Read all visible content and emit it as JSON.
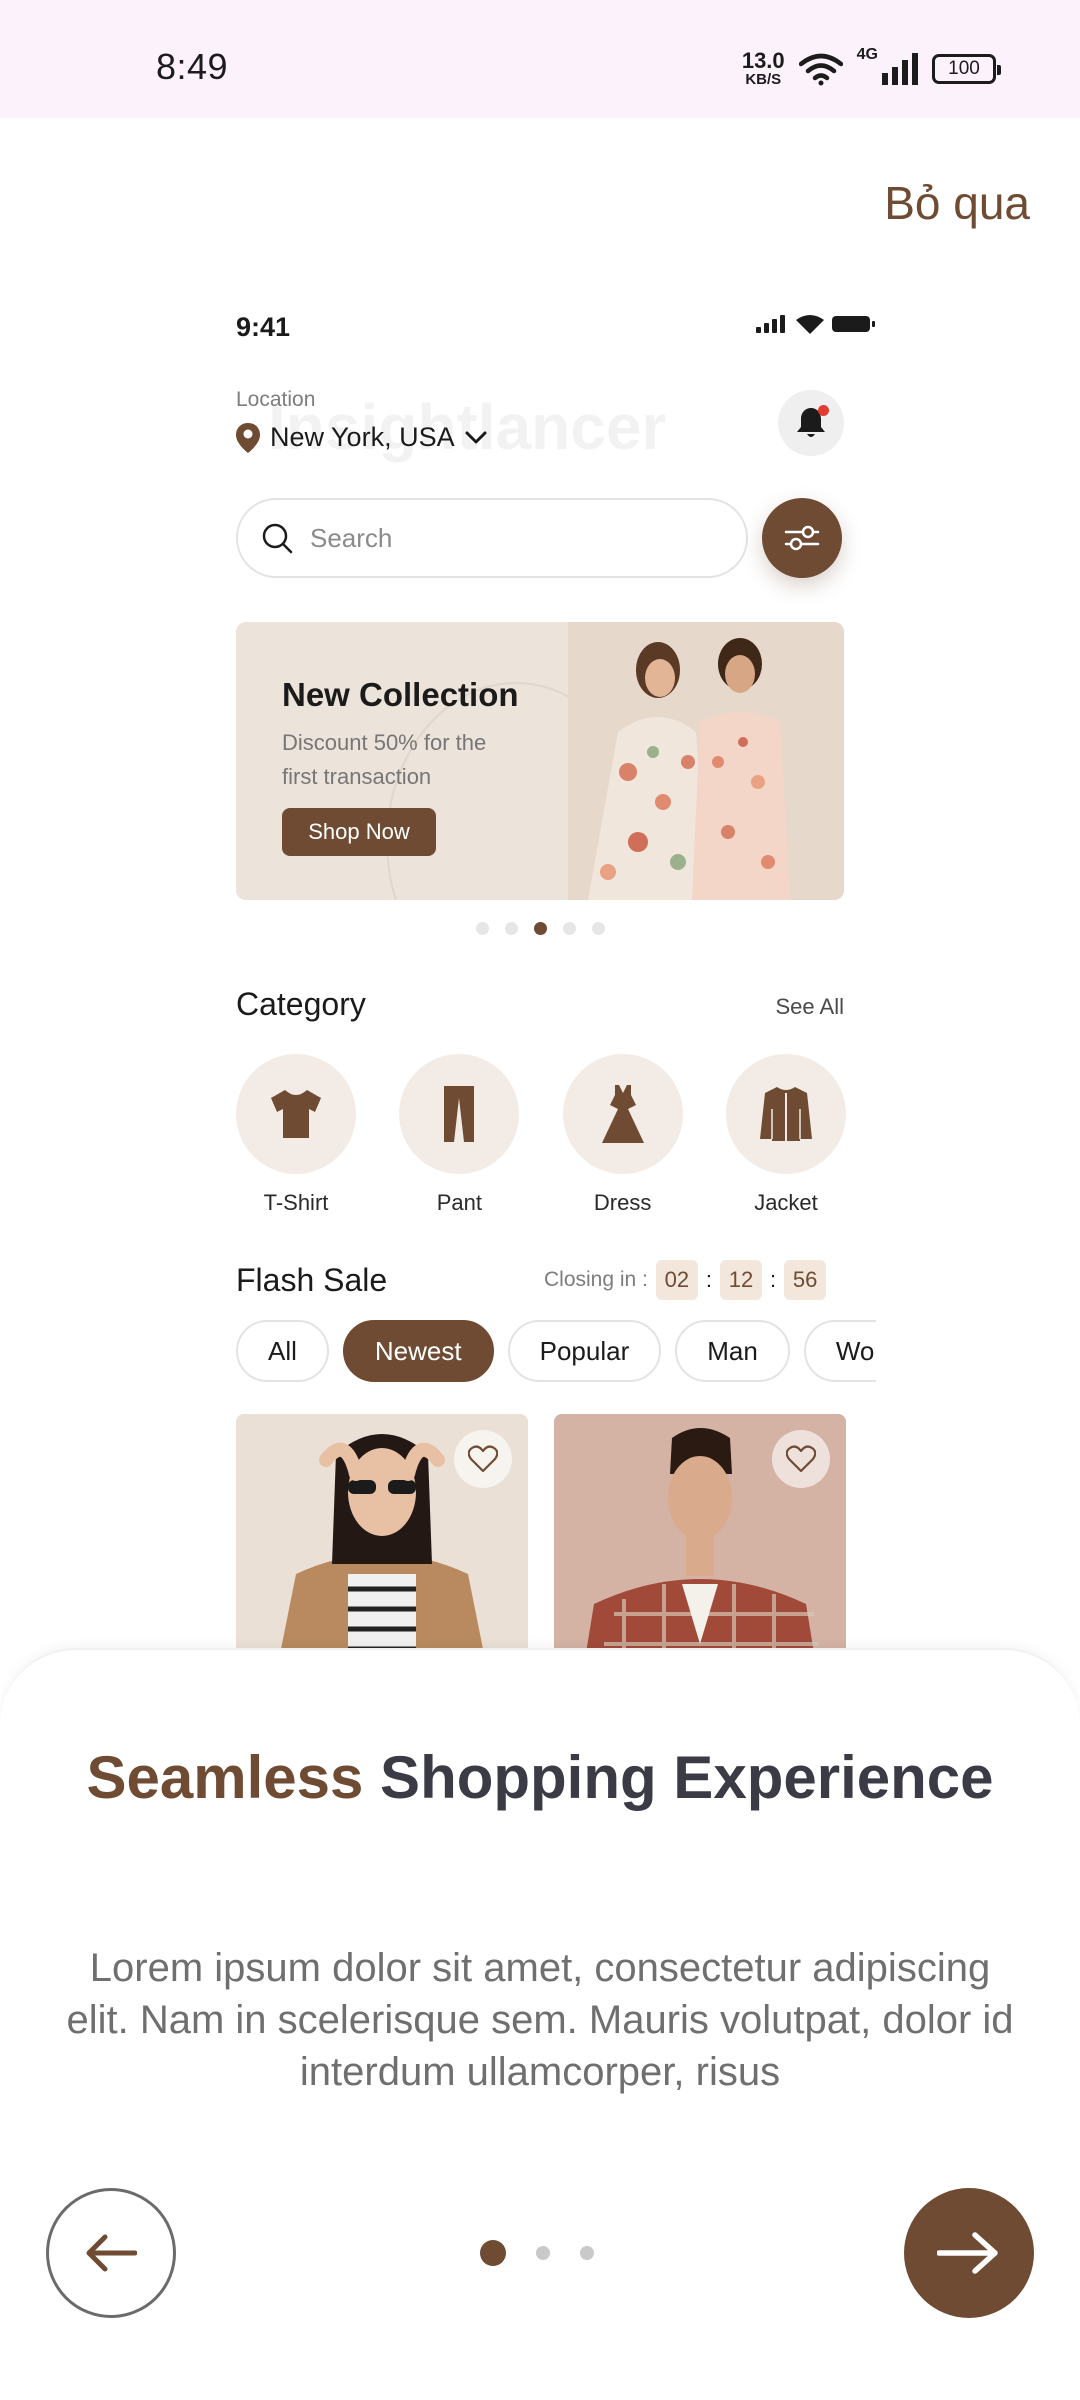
{
  "status_bar": {
    "time": "8:49",
    "net_speed": "13.0",
    "net_unit": "KB/S",
    "network": "4G",
    "battery": "100",
    "icons": [
      "wifi-icon",
      "signal-icon",
      "battery-icon"
    ]
  },
  "skip_label": "Bỏ qua",
  "mockup": {
    "time": "9:41",
    "location_label": "Location",
    "location_value": "New York, USA",
    "watermark": "Insightlancer",
    "search_placeholder": "Search",
    "banner": {
      "title": "New Collection",
      "subtitle": "Discount 50% for the first transaction",
      "button": "Shop Now"
    },
    "banner_dots": {
      "count": 5,
      "active_index": 2
    },
    "category": {
      "title": "Category",
      "see_all": "See All",
      "items": [
        {
          "label": "T-Shirt",
          "icon": "tshirt-icon"
        },
        {
          "label": "Pant",
          "icon": "pant-icon"
        },
        {
          "label": "Dress",
          "icon": "dress-icon"
        },
        {
          "label": "Jacket",
          "icon": "jacket-icon"
        }
      ]
    },
    "flash_sale": {
      "title": "Flash Sale",
      "closing_label": "Closing in :",
      "hours": "02",
      "minutes": "12",
      "seconds": "56",
      "chips": [
        "All",
        "Newest",
        "Popular",
        "Man",
        "Wor"
      ],
      "active_chip": "Newest"
    }
  },
  "onboarding": {
    "title_accent": "Seamless",
    "title_rest": " Shopping Experience",
    "description": "Lorem ipsum dolor sit amet, consectetur adipiscing elit. Nam in scelerisque sem. Mauris volutpat, dolor id interdum ullamcorper, risus",
    "page_count": 3,
    "active_page": 0
  },
  "colors": {
    "accent": "#6e4b32",
    "status_bar_bg": "#fcf2fc",
    "heading": "#3b3b45",
    "body_text": "#6f6f6f"
  }
}
